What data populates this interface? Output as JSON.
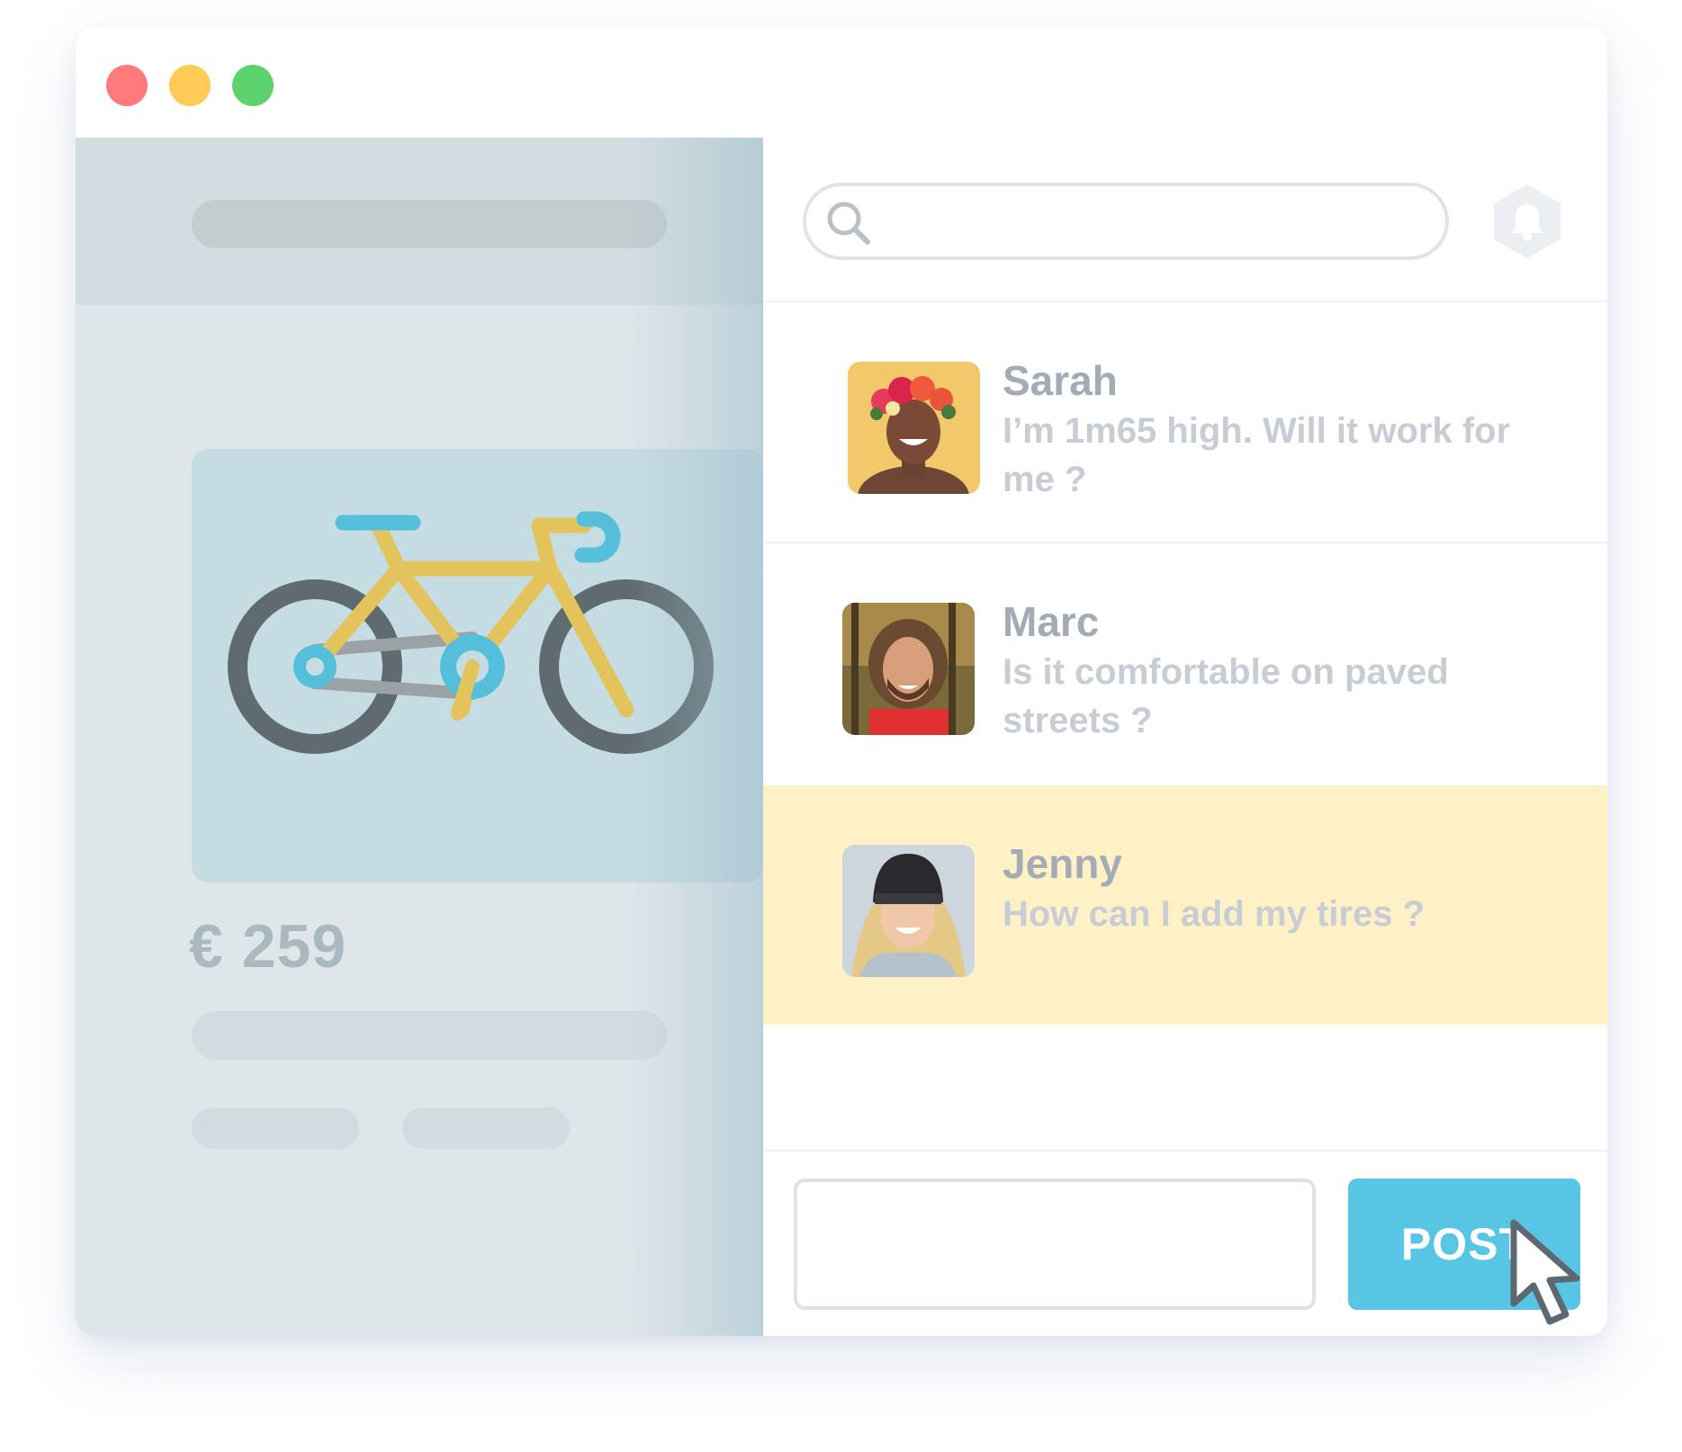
{
  "window": {
    "controls": [
      {
        "name": "close",
        "color": "#ff7b7b"
      },
      {
        "name": "minimize",
        "color": "#ffca55"
      },
      {
        "name": "maximize",
        "color": "#5cd36c"
      }
    ]
  },
  "product": {
    "image_icon": "bicycle-icon",
    "price": "€ 259"
  },
  "header": {
    "search_icon": "search-icon",
    "notification_icon": "bell-icon"
  },
  "comments": [
    {
      "name": "Sarah",
      "text": "I’m 1m65 high. Will it work for me ?",
      "highlighted": false
    },
    {
      "name": "Marc",
      "text": "Is it comfortable on paved streets ?",
      "highlighted": false
    },
    {
      "name": "Jenny",
      "text": "How can I add my tires ?",
      "highlighted": true
    }
  ],
  "composer": {
    "post_label": "POST"
  },
  "colors": {
    "accent": "#58c5e4",
    "highlight": "#fff0c6",
    "bike_frame": "#e3c45c",
    "bike_wheels": "#606b6f",
    "bike_parts": "#55bedb"
  }
}
